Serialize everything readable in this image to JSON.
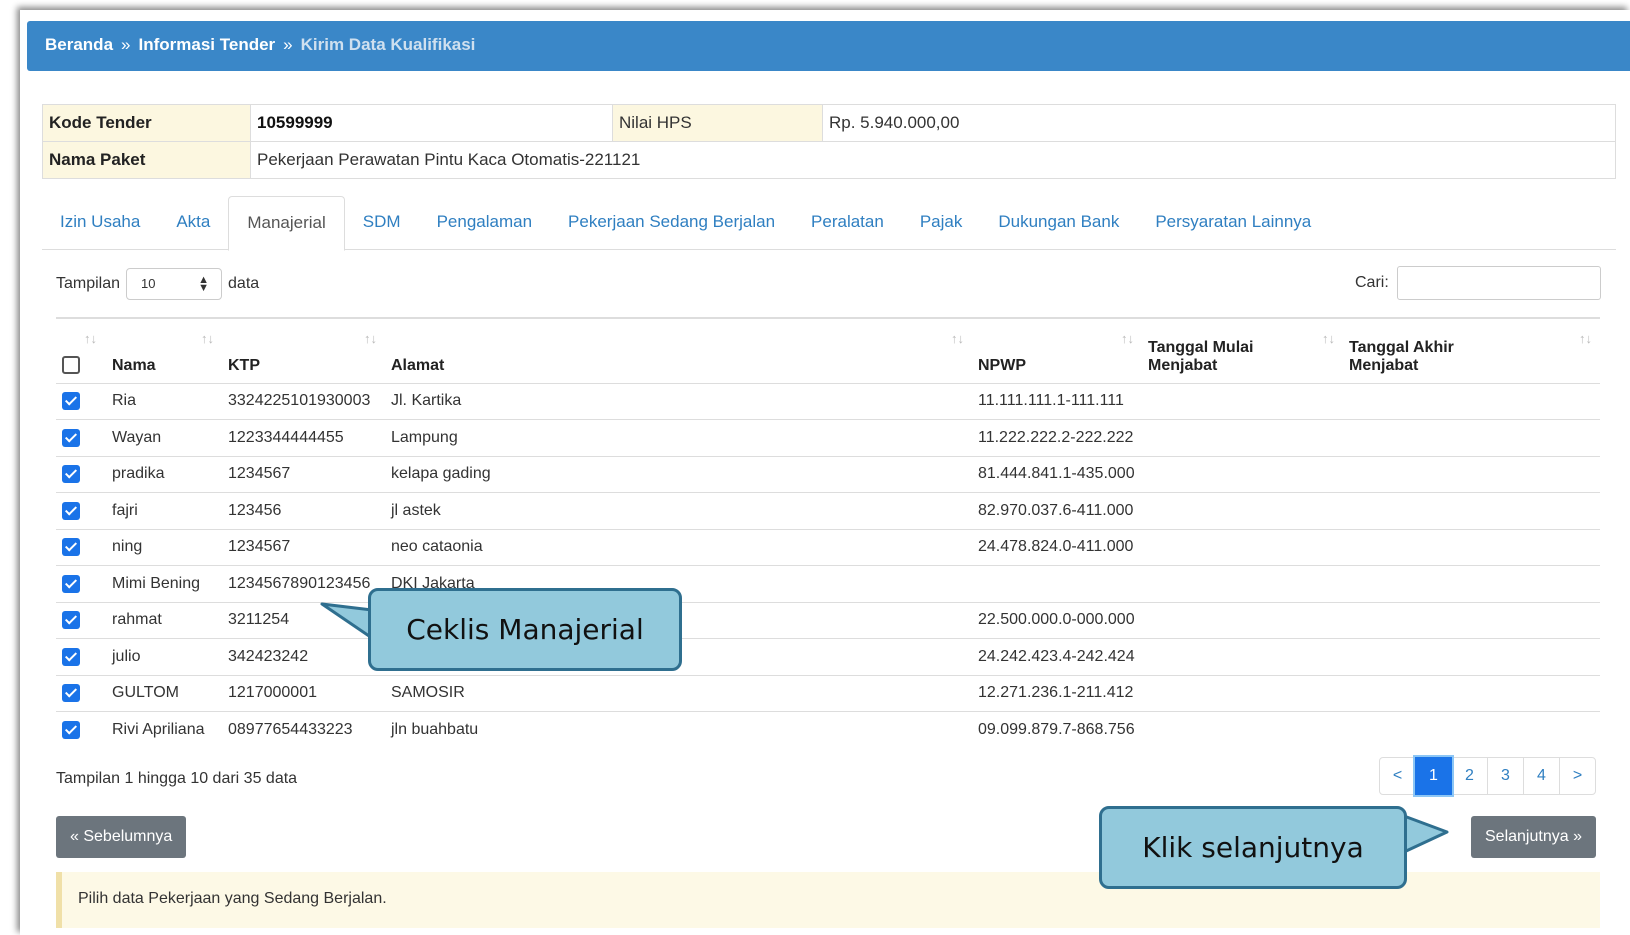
{
  "breadcrumb": {
    "home": "Beranda",
    "sep": "»",
    "tender_info": "Informasi Tender",
    "current": "Kirim Data Kualifikasi"
  },
  "tender": {
    "kode_label": "Kode Tender",
    "kode_value": "10599999",
    "hps_label": "Nilai HPS",
    "hps_value": "Rp. 5.940.000,00",
    "paket_label": "Nama Paket",
    "paket_value": "Pekerjaan Perawatan Pintu Kaca Otomatis-221121"
  },
  "tabs": [
    "Izin Usaha",
    "Akta",
    "Manajerial",
    "SDM",
    "Pengalaman",
    "Pekerjaan Sedang Berjalan",
    "Peralatan",
    "Pajak",
    "Dukungan Bank",
    "Persyaratan Lainnya"
  ],
  "active_tab": "Manajerial",
  "length": {
    "prefix": "Tampilan",
    "value": "10",
    "suffix": "data"
  },
  "search": {
    "label": "Cari:",
    "value": ""
  },
  "columns": [
    "Nama",
    "KTP",
    "Alamat",
    "NPWP",
    "Tanggal Mulai Menjabat",
    "Tanggal Akhir Menjabat"
  ],
  "rows": [
    {
      "checked": true,
      "nama": "Ria",
      "ktp": "3324225101930003",
      "alamat": "Jl. Kartika",
      "npwp": "11.111.111.1-111.111",
      "mulai": "",
      "akhir": ""
    },
    {
      "checked": true,
      "nama": "Wayan",
      "ktp": "1223344444455",
      "alamat": "Lampung",
      "npwp": "11.222.222.2-222.222",
      "mulai": "",
      "akhir": ""
    },
    {
      "checked": true,
      "nama": "pradika",
      "ktp": "1234567",
      "alamat": "kelapa gading",
      "npwp": "81.444.841.1-435.000",
      "mulai": "",
      "akhir": ""
    },
    {
      "checked": true,
      "nama": "fajri",
      "ktp": "123456",
      "alamat": "jl astek",
      "npwp": "82.970.037.6-411.000",
      "mulai": "",
      "akhir": ""
    },
    {
      "checked": true,
      "nama": "ning",
      "ktp": "1234567",
      "alamat": "neo cataonia",
      "npwp": "24.478.824.0-411.000",
      "mulai": "",
      "akhir": ""
    },
    {
      "checked": true,
      "nama": "Mimi Bening",
      "ktp": "1234567890123456",
      "alamat": "DKI Jakarta",
      "npwp": "",
      "mulai": "",
      "akhir": ""
    },
    {
      "checked": true,
      "nama": "rahmat",
      "ktp": "3211254",
      "alamat": "",
      "npwp": "22.500.000.0-000.000",
      "mulai": "",
      "akhir": ""
    },
    {
      "checked": true,
      "nama": "julio",
      "ktp": "342423242",
      "alamat": "",
      "npwp": "24.242.423.4-242.424",
      "mulai": "",
      "akhir": ""
    },
    {
      "checked": true,
      "nama": "GULTOM",
      "ktp": "1217000001",
      "alamat": "SAMOSIR",
      "npwp": "12.271.236.1-211.412",
      "mulai": "",
      "akhir": ""
    },
    {
      "checked": true,
      "nama": "Rivi Apriliana",
      "ktp": "08977654433223",
      "alamat": "jln buahbatu",
      "npwp": "09.099.879.7-868.756",
      "mulai": "",
      "akhir": ""
    }
  ],
  "table_info": "Tampilan 1 hingga 10 dari 35 data",
  "pagination": {
    "prev": "<",
    "pages": [
      "1",
      "2",
      "3",
      "4"
    ],
    "current": "1",
    "next": ">"
  },
  "buttons": {
    "prev": "« Sebelumnya",
    "next": "Selanjutnya »"
  },
  "alert": "Pilih data Pekerjaan yang Sedang Berjalan.",
  "callouts": {
    "check": "Ceklis Manajerial",
    "next": "Klik selanjutnya"
  },
  "colors": {
    "header": "#3a87c8",
    "accent": "#1a73e8",
    "callout": "#92c9dc",
    "callout_border": "#2f6f8f",
    "button": "#6c757d"
  }
}
